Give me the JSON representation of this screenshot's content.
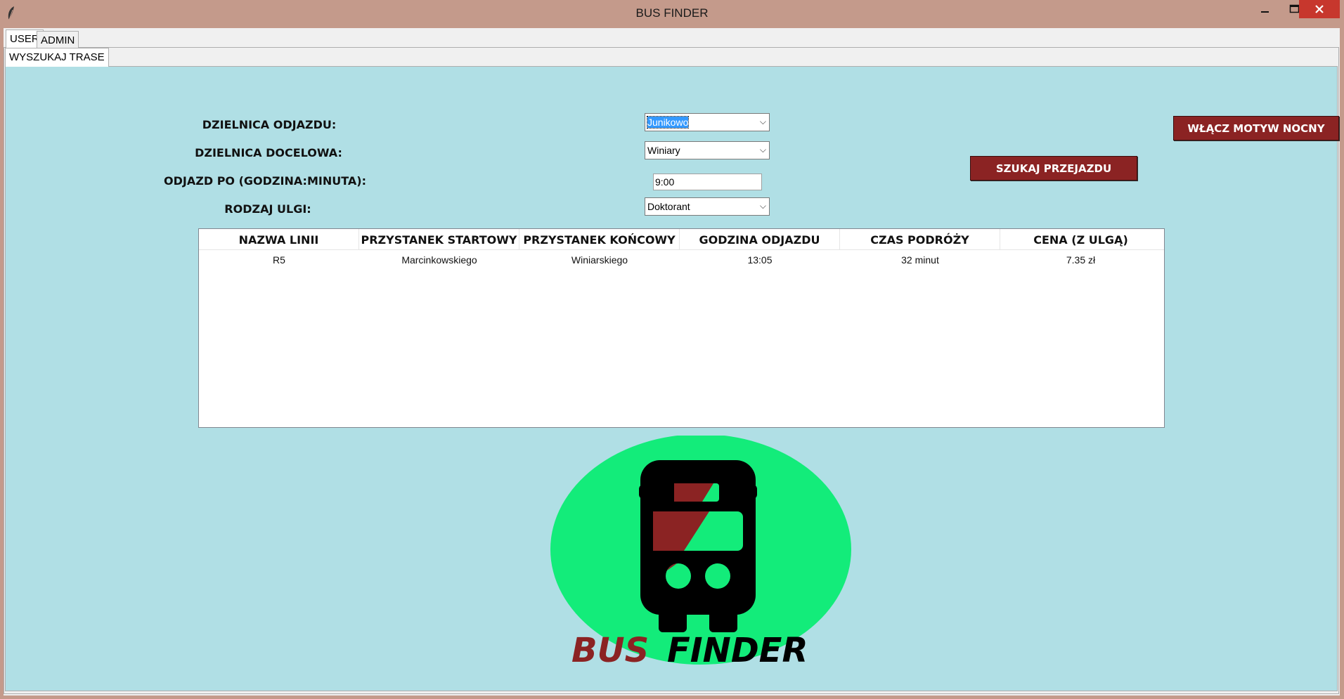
{
  "window": {
    "title": "BUS FINDER"
  },
  "tabs": {
    "user": "USER",
    "admin": "ADMIN",
    "search": "WYSZUKAJ TRASE"
  },
  "buttons": {
    "night_mode": "WŁĄCZ MOTYW NOCNY",
    "search": "SZUKAJ PRZEJAZDU"
  },
  "form": {
    "departure_label": "DZIELNICA ODJAZDU:",
    "departure_value": "Junikowo",
    "destination_label": "DZIELNICA DOCELOWA:",
    "destination_value": "Winiary",
    "time_label": "ODJAZD PO (GODZINA:MINUTA):",
    "time_value": "9:00",
    "discount_label": "RODZAJ ULGI:",
    "discount_value": "Doktorant"
  },
  "table": {
    "headers": [
      "NAZWA LINII",
      "PRZYSTANEK STARTOWY",
      "PRZYSTANEK KOŃCOWY",
      "GODZINA ODJAZDU",
      "CZAS PODRÓŻY",
      "CENA (Z ULGĄ)"
    ],
    "rows": [
      [
        "R5",
        "Marcinkowskiego",
        "Winiarskiego",
        "13:05",
        "32 minut",
        "7.35 zł"
      ]
    ]
  },
  "logo": {
    "word1": "BUS",
    "word2": "FINDER"
  },
  "colors": {
    "background": "#b0dfe5",
    "accent": "#8b2323",
    "logo_circle": "#13ec7a",
    "titlebar": "#c49a8b"
  }
}
